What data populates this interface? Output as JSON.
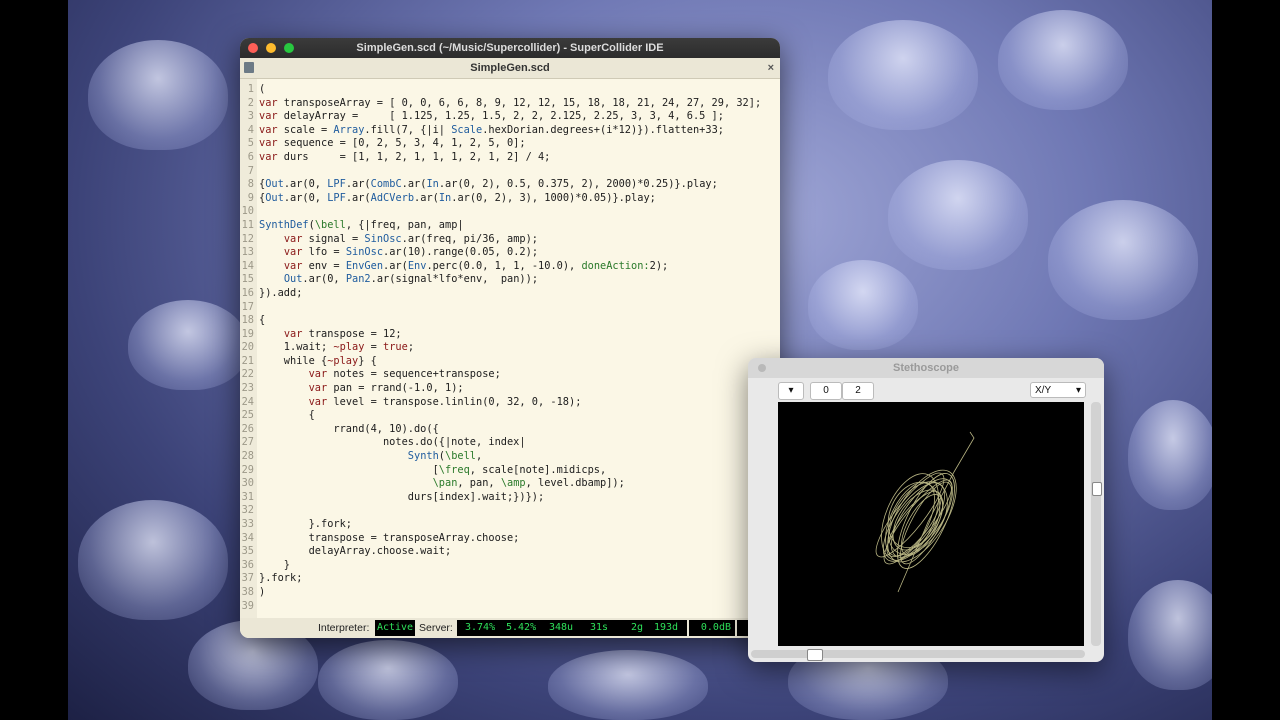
{
  "ide": {
    "window_title": "SimpleGen.scd (~/Music/Supercollider) - SuperCollider IDE",
    "doc_tab": "SimpleGen.scd",
    "close_glyph": "×"
  },
  "code_lines": [
    [
      {
        "t": "("
      }
    ],
    [
      {
        "t": "var",
        "c": "kw"
      },
      {
        "t": " transposeArray = [ 0, 0, 6, 6, 8, 9, 12, 12, 15, 18, 18, 21, 24, 27, 29, 32];"
      }
    ],
    [
      {
        "t": "var",
        "c": "kw"
      },
      {
        "t": " delayArray =     [ 1.125, 1.25, 1.5, 2, 2, 2.125, 2.25, 3, 3, 4, 6.5 ];"
      }
    ],
    [
      {
        "t": "var",
        "c": "kw"
      },
      {
        "t": " scale = "
      },
      {
        "t": "Array",
        "c": "cls"
      },
      {
        "t": ".fill(7, {|i| "
      },
      {
        "t": "Scale",
        "c": "cls"
      },
      {
        "t": ".hexDorian.degrees+(i*12)}).flatten+33;"
      }
    ],
    [
      {
        "t": "var",
        "c": "kw"
      },
      {
        "t": " sequence = [0, 2, 5, 3, 4, 1, 2, 5, 0];"
      }
    ],
    [
      {
        "t": "var",
        "c": "kw"
      },
      {
        "t": " durs     = [1, 1, 2, 1, 1, 1, 2, 1, 2] / 4;"
      }
    ],
    [
      {
        "t": ""
      }
    ],
    [
      {
        "t": "{"
      },
      {
        "t": "Out",
        "c": "cls"
      },
      {
        "t": ".ar(0, "
      },
      {
        "t": "LPF",
        "c": "cls"
      },
      {
        "t": ".ar("
      },
      {
        "t": "CombC",
        "c": "cls"
      },
      {
        "t": ".ar("
      },
      {
        "t": "In",
        "c": "cls"
      },
      {
        "t": ".ar(0, 2), 0.5, 0.375, 2), 2000)*0.25)}.play;"
      }
    ],
    [
      {
        "t": "{"
      },
      {
        "t": "Out",
        "c": "cls"
      },
      {
        "t": ".ar(0, "
      },
      {
        "t": "LPF",
        "c": "cls"
      },
      {
        "t": ".ar("
      },
      {
        "t": "AdCVerb",
        "c": "cls"
      },
      {
        "t": ".ar("
      },
      {
        "t": "In",
        "c": "cls"
      },
      {
        "t": ".ar(0, 2), 3), 1000)*0.05)}.play;"
      }
    ],
    [
      {
        "t": ""
      }
    ],
    [
      {
        "t": "SynthDef",
        "c": "cls"
      },
      {
        "t": "("
      },
      {
        "t": "\\bell",
        "c": "sym"
      },
      {
        "t": ", {|freq, pan, amp|"
      }
    ],
    [
      {
        "t": "    "
      },
      {
        "t": "var",
        "c": "kw"
      },
      {
        "t": " signal = "
      },
      {
        "t": "SinOsc",
        "c": "cls"
      },
      {
        "t": ".ar(freq, pi/36, amp);"
      }
    ],
    [
      {
        "t": "    "
      },
      {
        "t": "var",
        "c": "kw"
      },
      {
        "t": " lfo = "
      },
      {
        "t": "SinOsc",
        "c": "cls"
      },
      {
        "t": ".ar(10).range(0.05, 0.2);"
      }
    ],
    [
      {
        "t": "    "
      },
      {
        "t": "var",
        "c": "kw"
      },
      {
        "t": " env = "
      },
      {
        "t": "EnvGen",
        "c": "cls"
      },
      {
        "t": ".ar("
      },
      {
        "t": "Env",
        "c": "cls"
      },
      {
        "t": ".perc(0.0, 1, 1, -10.0), "
      },
      {
        "t": "doneAction:",
        "c": "sym"
      },
      {
        "t": "2);"
      }
    ],
    [
      {
        "t": "    "
      },
      {
        "t": "Out",
        "c": "cls"
      },
      {
        "t": ".ar(0, "
      },
      {
        "t": "Pan2",
        "c": "cls"
      },
      {
        "t": ".ar(signal*lfo*env,  pan));"
      }
    ],
    [
      {
        "t": "}).add;"
      }
    ],
    [
      {
        "t": ""
      }
    ],
    [
      {
        "t": "{"
      }
    ],
    [
      {
        "t": "    "
      },
      {
        "t": "var",
        "c": "kw"
      },
      {
        "t": " transpose = 12;"
      }
    ],
    [
      {
        "t": "    1.wait; "
      },
      {
        "t": "~play",
        "c": "kw"
      },
      {
        "t": " = "
      },
      {
        "t": "true",
        "c": "kw"
      },
      {
        "t": ";"
      }
    ],
    [
      {
        "t": "    while {"
      },
      {
        "t": "~play",
        "c": "kw"
      },
      {
        "t": "} {"
      }
    ],
    [
      {
        "t": "        "
      },
      {
        "t": "var",
        "c": "kw"
      },
      {
        "t": " notes = sequence+transpose;"
      }
    ],
    [
      {
        "t": "        "
      },
      {
        "t": "var",
        "c": "kw"
      },
      {
        "t": " pan = rrand(-1.0, 1);"
      }
    ],
    [
      {
        "t": "        "
      },
      {
        "t": "var",
        "c": "kw"
      },
      {
        "t": " level = transpose.linlin(0, 32, 0, -18);"
      }
    ],
    [
      {
        "t": "        {"
      }
    ],
    [
      {
        "t": "            rrand(4, 10).do({"
      }
    ],
    [
      {
        "t": "                    notes.do({|note, index|"
      }
    ],
    [
      {
        "t": "                        "
      },
      {
        "t": "Synth",
        "c": "cls"
      },
      {
        "t": "("
      },
      {
        "t": "\\bell",
        "c": "sym"
      },
      {
        "t": ","
      }
    ],
    [
      {
        "t": "                            ["
      },
      {
        "t": "\\freq",
        "c": "sym"
      },
      {
        "t": ", scale[note].midicps,"
      }
    ],
    [
      {
        "t": "                            "
      },
      {
        "t": "\\pan",
        "c": "sym"
      },
      {
        "t": ", pan, "
      },
      {
        "t": "\\amp",
        "c": "sym"
      },
      {
        "t": ", level.dbamp]);"
      }
    ],
    [
      {
        "t": "                        durs[index].wait;})});"
      }
    ],
    [
      {
        "t": ""
      }
    ],
    [
      {
        "t": "        }.fork;"
      }
    ],
    [
      {
        "t": "        transpose = transposeArray.choose;"
      }
    ],
    [
      {
        "t": "        delayArray.choose.wait;"
      }
    ],
    [
      {
        "t": "    }"
      }
    ],
    [
      {
        "t": "}.fork;"
      }
    ],
    [
      {
        "t": ")"
      }
    ],
    [
      {
        "t": ""
      }
    ]
  ],
  "status": {
    "interpreter_label": "Interpreter:",
    "interpreter_state": "Active",
    "server_label": "Server:",
    "avg_cpu": "3.74%",
    "peak_cpu": "5.42%",
    "ugens": "348u",
    "synths": "31s",
    "groups": "2g",
    "synthdefs": "193d",
    "volume": "0.0dB"
  },
  "stethoscope": {
    "title": "Stethoscope",
    "channel_offset": "0",
    "channel_count": "2",
    "view_mode": "X/Y",
    "trace_color": "#d8d49a"
  }
}
